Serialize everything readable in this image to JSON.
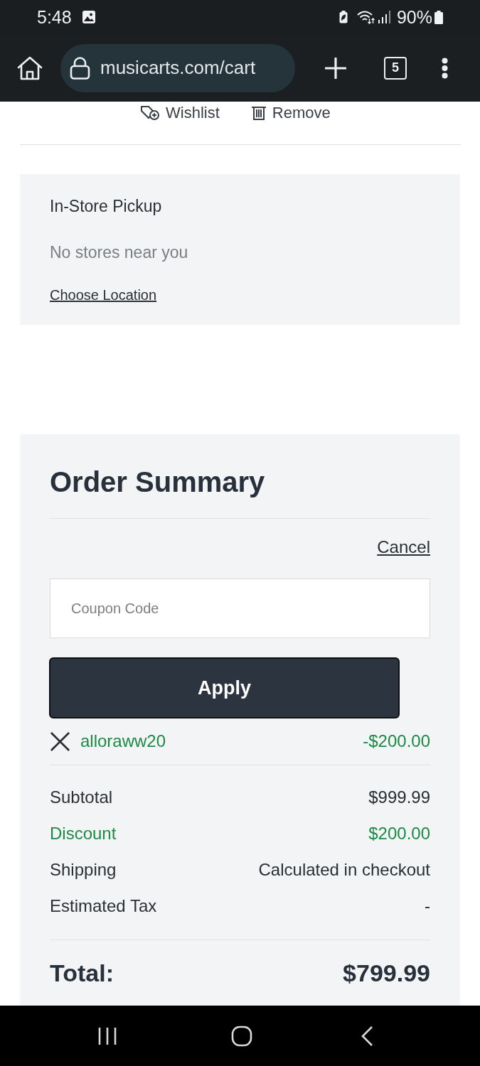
{
  "status_bar": {
    "time": "5:48",
    "battery": "90%"
  },
  "browser_bar": {
    "url": "musicarts.com/cart",
    "tab_count": "5"
  },
  "item_actions": [
    {
      "kind": "wishlist",
      "label": "Wishlist"
    },
    {
      "kind": "remove",
      "label": "Remove"
    }
  ],
  "pickup": {
    "title": "In-Store Pickup",
    "message": "No stores near you",
    "link": "Choose Location"
  },
  "order_summary": {
    "title": "Order Summary",
    "cancel": "Cancel",
    "coupon_field": {
      "placeholder": "Coupon Code"
    },
    "apply_button": "Apply",
    "applied_coupon": {
      "code": "alloraww20",
      "amount": "-$200.00"
    },
    "lines": [
      {
        "kind": "plain",
        "label": "Subtotal",
        "value": "$999.99"
      },
      {
        "kind": "discount",
        "label": "Discount",
        "value": "$200.00"
      },
      {
        "kind": "plain",
        "label": "Shipping",
        "value": "Calculated in checkout"
      },
      {
        "kind": "plain",
        "label": "Estimated Tax",
        "value": "-"
      }
    ],
    "total": {
      "label": "Total:",
      "value": "$799.99"
    }
  }
}
